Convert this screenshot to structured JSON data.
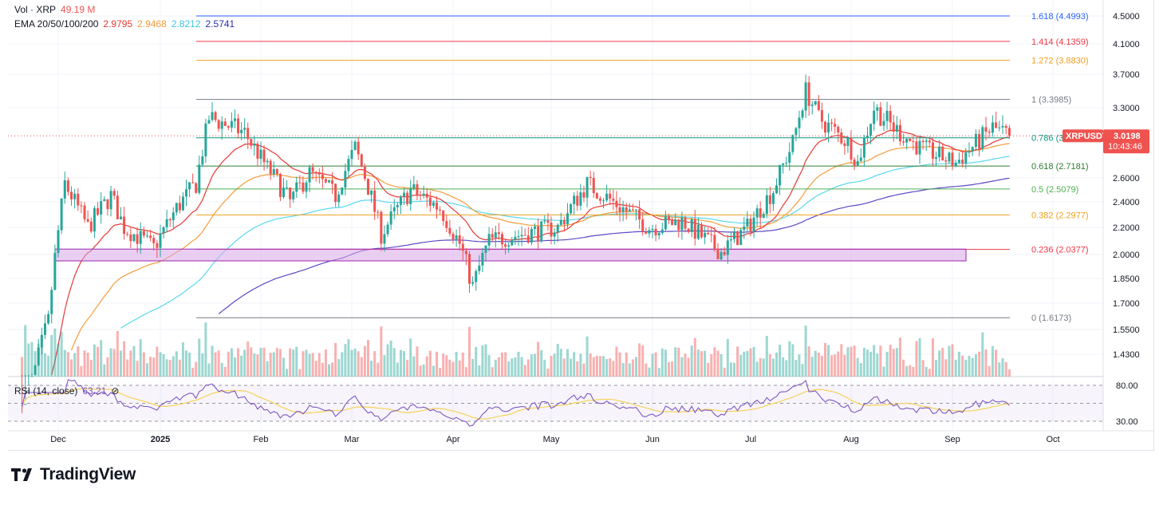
{
  "legend": {
    "vol_label": "Vol · XRP",
    "vol_value": "49.19 M",
    "ema_label": "EMA 20/50/100/200",
    "ema20": "2.9795",
    "ema50": "2.9468",
    "ema100": "2.8212",
    "ema200": "2.5741",
    "rsi_label": "RSI (14, close)",
    "rsi_value": "63.21"
  },
  "price_tag": {
    "symbol": "XRPUSDT",
    "price": "3.0198",
    "countdown": "10:43:46"
  },
  "brand": {
    "name": "TradingView"
  },
  "colors": {
    "up": "#26a69a",
    "down": "#ef5350",
    "ema20": "#e53935",
    "ema50": "#f59c3a",
    "ema100": "#5ad8ee",
    "ema200": "#5b49c4",
    "rsi": "#7e57c2",
    "rsi_ma": "#f5d25a",
    "zone": "#d9a8e8"
  },
  "chart_data": {
    "type": "candlestick",
    "symbol": "XRPUSDT",
    "price_axis_ticks": [
      "4.5000",
      "4.1000",
      "3.7000",
      "3.3000",
      "2.6000",
      "2.4000",
      "2.2000",
      "2.0000",
      "1.8500",
      "1.7000",
      "1.5500",
      "1.4300"
    ],
    "rsi_axis_ticks": [
      "80.00",
      "30.00"
    ],
    "time_axis_ticks": [
      "Dec",
      "2025",
      "Feb",
      "Mar",
      "Apr",
      "May",
      "Jun",
      "Jul",
      "Aug",
      "Sep",
      "Oct"
    ],
    "fib_levels": [
      {
        "label": "1.618 (4.4993)",
        "value": 4.4993,
        "color": "#2962ff"
      },
      {
        "label": "1.414 (4.1359)",
        "value": 4.1359,
        "color": "#f23645"
      },
      {
        "label": "1.272 (3.8830)",
        "value": 3.883,
        "color": "#f0a020"
      },
      {
        "label": "1 (3.3985)",
        "value": 3.3985,
        "color": "#787b86"
      },
      {
        "label": "0.786 (3",
        "value": 3.0,
        "color": "#089981"
      },
      {
        "label": "0.618 (2.7181)",
        "value": 2.7181,
        "color": "#2e7d32"
      },
      {
        "label": "0.5 (2.5079)",
        "value": 2.5079,
        "color": "#4caf50"
      },
      {
        "label": "0.382 (2.2977)",
        "value": 2.2977,
        "color": "#f0a020"
      },
      {
        "label": "0.236 (2.0377)",
        "value": 2.0377,
        "color": "#f23645"
      },
      {
        "label": "0 (1.6173)",
        "value": 1.6173,
        "color": "#787b86"
      }
    ],
    "support_zone": {
      "low": 1.96,
      "high": 2.04
    },
    "close_anchors": [
      [
        "2024-11-20",
        1.12
      ],
      [
        "2024-11-28",
        1.6
      ],
      [
        "2024-12-03",
        2.55
      ],
      [
        "2024-12-10",
        2.2
      ],
      [
        "2024-12-17",
        2.45
      ],
      [
        "2024-12-21",
        2.2
      ],
      [
        "2024-12-30",
        2.05
      ],
      [
        "2025-01-06",
        2.35
      ],
      [
        "2025-01-12",
        2.55
      ],
      [
        "2025-01-16",
        3.2
      ],
      [
        "2025-01-20",
        3.15
      ],
      [
        "2025-01-27",
        3.05
      ],
      [
        "2025-02-03",
        2.7
      ],
      [
        "2025-02-10",
        2.4
      ],
      [
        "2025-02-16",
        2.65
      ],
      [
        "2025-02-24",
        2.45
      ],
      [
        "2025-03-02",
        2.9
      ],
      [
        "2025-03-10",
        2.15
      ],
      [
        "2025-03-19",
        2.5
      ],
      [
        "2025-03-28",
        2.35
      ],
      [
        "2025-04-03",
        2.08
      ],
      [
        "2025-04-07",
        1.8
      ],
      [
        "2025-04-12",
        2.1
      ],
      [
        "2025-04-22",
        2.15
      ],
      [
        "2025-05-03",
        2.2
      ],
      [
        "2025-05-12",
        2.55
      ],
      [
        "2025-05-20",
        2.4
      ],
      [
        "2025-05-31",
        2.2
      ],
      [
        "2025-06-10",
        2.25
      ],
      [
        "2025-06-22",
        2.02
      ],
      [
        "2025-06-30",
        2.2
      ],
      [
        "2025-07-08",
        2.5
      ],
      [
        "2025-07-14",
        2.95
      ],
      [
        "2025-07-18",
        3.5
      ],
      [
        "2025-07-22",
        3.2
      ],
      [
        "2025-07-31",
        2.95
      ],
      [
        "2025-08-03",
        2.75
      ],
      [
        "2025-08-08",
        3.3
      ],
      [
        "2025-08-14",
        3.1
      ],
      [
        "2025-08-22",
        2.9
      ],
      [
        "2025-09-02",
        2.75
      ],
      [
        "2025-09-13",
        3.1
      ],
      [
        "2025-09-18",
        3.0198
      ]
    ]
  }
}
